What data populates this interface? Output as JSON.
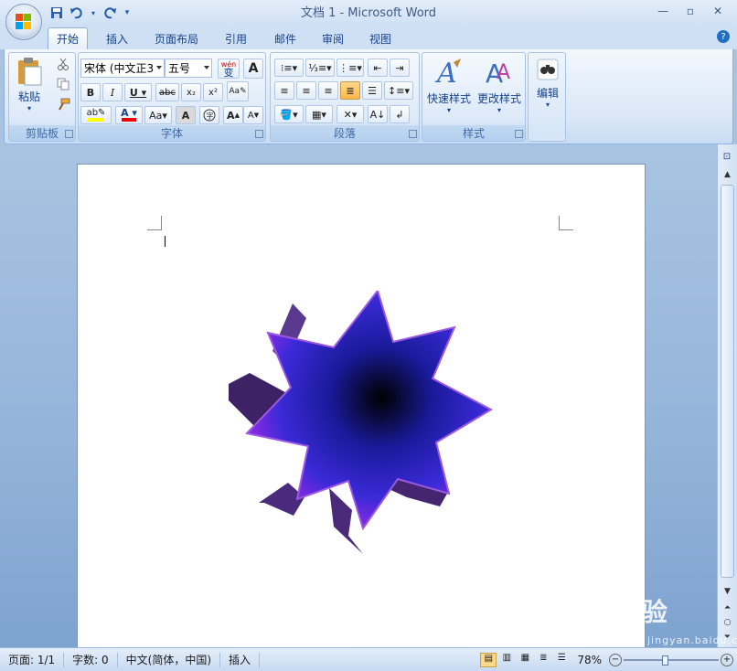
{
  "window": {
    "title": "文档 1 - Microsoft Word"
  },
  "quick_access": {
    "icons": [
      "save-icon",
      "undo-icon",
      "redo-icon",
      "customize-icon"
    ]
  },
  "tabs": [
    {
      "label": "开始",
      "active": true
    },
    {
      "label": "插入"
    },
    {
      "label": "页面布局"
    },
    {
      "label": "引用"
    },
    {
      "label": "邮件"
    },
    {
      "label": "审阅"
    },
    {
      "label": "视图"
    }
  ],
  "ribbon": {
    "clipboard": {
      "label": "剪贴板",
      "paste": "粘贴"
    },
    "font": {
      "label": "字体",
      "font_name": "宋体 (中文正3",
      "font_size": "五号",
      "wen": "wén",
      "phonetic_char": "变",
      "A_box": "A"
    },
    "paragraph": {
      "label": "段落"
    },
    "styles": {
      "label": "样式",
      "quick_styles": "快速样式",
      "change_styles": "更改样式"
    },
    "editing": {
      "label": "编辑"
    }
  },
  "status": {
    "page": "页面: 1/1",
    "words": "字数: 0",
    "language": "中文(简体，中国)",
    "mode": "插入",
    "zoom": "78%"
  },
  "watermark": {
    "text": "Bai经验",
    "sub": "jingyan.baidu.com"
  },
  "colors": {
    "accent": "#15428b",
    "ribbon_bg": "#dbe8f7",
    "star_fill_center": "#000000",
    "star_fill_edge": "#8a2be2",
    "star_side": "#4b2a7a"
  }
}
